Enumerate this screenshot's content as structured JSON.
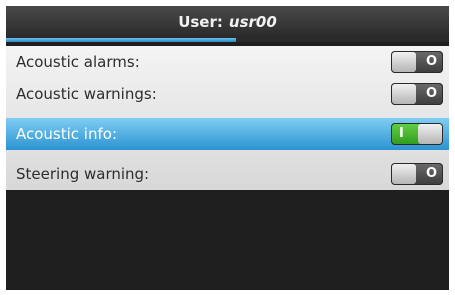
{
  "header": {
    "title_prefix": "User:",
    "user_name": "usr00"
  },
  "progress": {
    "fraction": 0.52
  },
  "settings": [
    {
      "label": "Acoustic alarms:",
      "state": "off",
      "toggle_text": "O",
      "selected": false
    },
    {
      "label": "Acoustic warnings:",
      "state": "off",
      "toggle_text": "O",
      "selected": false
    },
    {
      "label": "Acoustic info:",
      "state": "on",
      "toggle_text": "I",
      "selected": true
    },
    {
      "label": "Steering warning:",
      "state": "off",
      "toggle_text": "O",
      "selected": false
    }
  ],
  "colors": {
    "accent": "#2b93d1",
    "toggle_on": "#3fb52a",
    "toggle_off": "#4f4f4f"
  }
}
